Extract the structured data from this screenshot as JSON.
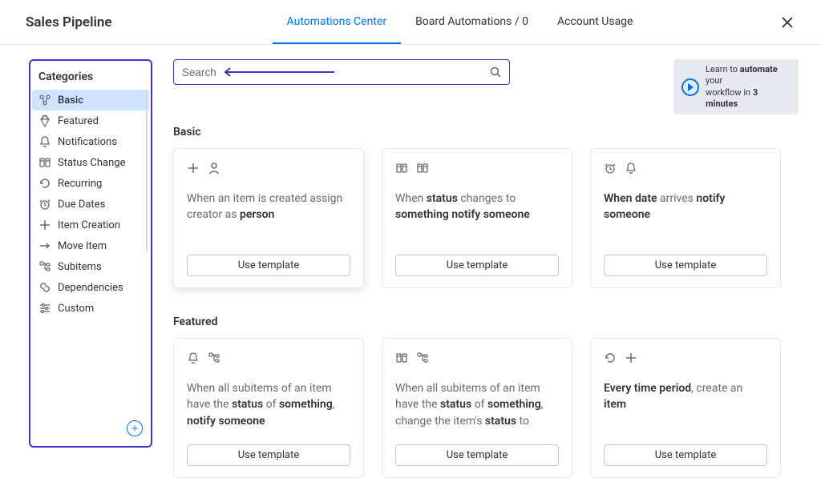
{
  "header": {
    "title": "Sales Pipeline",
    "tabs": [
      {
        "label": "Automations Center",
        "active": true
      },
      {
        "label": "Board Automations / 0",
        "active": false
      },
      {
        "label": "Account Usage",
        "active": false
      }
    ]
  },
  "sidebar": {
    "heading": "Categories",
    "items": [
      {
        "label": "Basic",
        "icon": "basic",
        "active": true
      },
      {
        "label": "Featured",
        "icon": "diamond",
        "active": false
      },
      {
        "label": "Notifications",
        "icon": "bell",
        "active": false
      },
      {
        "label": "Status Change",
        "icon": "status",
        "active": false
      },
      {
        "label": "Recurring",
        "icon": "recur",
        "active": false
      },
      {
        "label": "Due Dates",
        "icon": "clock",
        "active": false
      },
      {
        "label": "Item Creation",
        "icon": "plus",
        "active": false
      },
      {
        "label": "Move Item",
        "icon": "arrow",
        "active": false
      },
      {
        "label": "Subitems",
        "icon": "subitems",
        "active": false
      },
      {
        "label": "Dependencies",
        "icon": "link",
        "active": false
      },
      {
        "label": "Custom",
        "icon": "sliders",
        "active": false
      }
    ]
  },
  "search": {
    "placeholder": "Search"
  },
  "learn": {
    "line1_pre": "Learn to ",
    "line1_bold": "automate",
    "line1_post": " your",
    "line2_pre": "workflow in ",
    "line2_bold": "3 minutes"
  },
  "sections": {
    "basic": {
      "title": "Basic",
      "cards": [
        {
          "icons": [
            "plus",
            "person"
          ],
          "desc_html": "When an item is created assign creator as <b>person</b>",
          "button": "Use template",
          "highlighted": true
        },
        {
          "icons": [
            "status",
            "status"
          ],
          "desc_html": "When <b>status</b> changes to <b>something notify someone</b>",
          "button": "Use template"
        },
        {
          "icons": [
            "clock",
            "bell"
          ],
          "desc_html": "<b>When date</b> arrives <b>notify someone</b>",
          "button": "Use template"
        }
      ]
    },
    "featured": {
      "title": "Featured",
      "cards": [
        {
          "icons": [
            "bell",
            "subitems"
          ],
          "desc_html": "When all subitems of an item have the <b>status</b> of <b>something</b>, <b>notify someone</b>",
          "button": "Use template"
        },
        {
          "icons": [
            "status",
            "subitems"
          ],
          "desc_html": "When all subitems of an item have the <b>status</b> of <b>something</b>, change the item's <b>status</b> to",
          "button": "Use template"
        },
        {
          "icons": [
            "recur",
            "plus"
          ],
          "desc_html": "<b>Every time period</b>, create an <b>item</b>",
          "button": "Use template"
        }
      ]
    }
  }
}
